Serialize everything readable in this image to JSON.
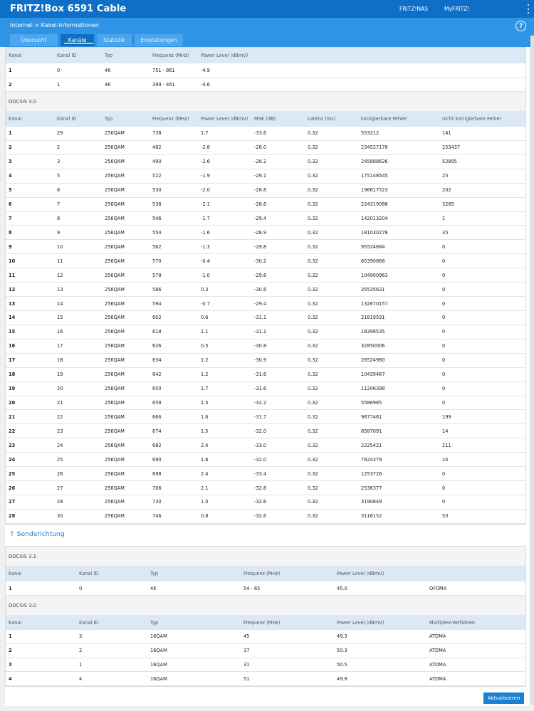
{
  "header": {
    "title": "FRITZ!Box 6591 Cable",
    "nav_nas": "FRITZ!NAS",
    "nav_myfritz": "MyFRITZ!"
  },
  "breadcrumb": {
    "parent": "Internet",
    "current": "Kabel-Informationen"
  },
  "help_label": "?",
  "tabs": [
    {
      "label": "Übersicht"
    },
    {
      "label": "Kanäle"
    },
    {
      "label": "Statistik"
    },
    {
      "label": "Einstellungen"
    }
  ],
  "downstream": {
    "ofdm_headers": [
      "Kanal",
      "Kanal ID",
      "Typ",
      "Frequenz (MHz)",
      "Power Level (dBmV)"
    ],
    "ofdm_rows": [
      [
        "1",
        "0",
        "4K",
        "751 - 861",
        "-4.9"
      ],
      [
        "2",
        "1",
        "4K",
        "399 - 461",
        "-4.6"
      ]
    ],
    "docsis30_label": "DOCSIS 3.0",
    "headers": [
      "Kanal",
      "Kanal ID",
      "Typ",
      "Frequenz (MHz)",
      "Power Level (dBmV)",
      "MSE (dB)",
      "Latenz (ms)",
      "korrigierbare Fehler",
      "nicht korrigierbare Fehler"
    ],
    "rows": [
      [
        "1",
        "29",
        "256QAM",
        "738",
        "1.7",
        "-33.6",
        "0.32",
        "553212",
        "141"
      ],
      [
        "2",
        "2",
        "256QAM",
        "482",
        "-2.8",
        "-28.0",
        "0.32",
        "234527178",
        "253437"
      ],
      [
        "3",
        "3",
        "256QAM",
        "490",
        "-2.6",
        "-28.2",
        "0.32",
        "245888626",
        "52895"
      ],
      [
        "4",
        "5",
        "256QAM",
        "522",
        "-1.9",
        "-29.1",
        "0.32",
        "175148545",
        "25"
      ],
      [
        "5",
        "6",
        "256QAM",
        "530",
        "-2.0",
        "-28.8",
        "0.32",
        "196617523",
        "202"
      ],
      [
        "6",
        "7",
        "256QAM",
        "538",
        "-2.1",
        "-28.6",
        "0.32",
        "224319086",
        "3285"
      ],
      [
        "7",
        "8",
        "256QAM",
        "546",
        "-1.7",
        "-29.4",
        "0.32",
        "142013204",
        "1"
      ],
      [
        "8",
        "9",
        "256QAM",
        "554",
        "-1.6",
        "-28.9",
        "0.32",
        "181030278",
        "35"
      ],
      [
        "9",
        "10",
        "256QAM",
        "562",
        "-1.3",
        "-29.8",
        "0.32",
        "95524684",
        "0"
      ],
      [
        "10",
        "11",
        "256QAM",
        "570",
        "-0.4",
        "-30.2",
        "0.32",
        "65390868",
        "0"
      ],
      [
        "11",
        "12",
        "256QAM",
        "578",
        "-1.0",
        "-29.6",
        "0.32",
        "104900963",
        "0"
      ],
      [
        "12",
        "13",
        "256QAM",
        "586",
        "0.3",
        "-30.6",
        "0.32",
        "35535631",
        "0"
      ],
      [
        "13",
        "14",
        "256QAM",
        "594",
        "-0.7",
        "-29.4",
        "0.32",
        "132670157",
        "0"
      ],
      [
        "14",
        "15",
        "256QAM",
        "602",
        "0.6",
        "-31.1",
        "0.32",
        "21819591",
        "0"
      ],
      [
        "15",
        "16",
        "256QAM",
        "618",
        "1.1",
        "-31.1",
        "0.32",
        "18398535",
        "0"
      ],
      [
        "16",
        "17",
        "256QAM",
        "626",
        "0.5",
        "-30.8",
        "0.32",
        "32850006",
        "0"
      ],
      [
        "17",
        "18",
        "256QAM",
        "634",
        "1.2",
        "-30.9",
        "0.32",
        "26524980",
        "0"
      ],
      [
        "18",
        "19",
        "256QAM",
        "642",
        "1.2",
        "-31.6",
        "0.32",
        "10439467",
        "0"
      ],
      [
        "19",
        "20",
        "256QAM",
        "650",
        "1.7",
        "-31.6",
        "0.32",
        "11206398",
        "0"
      ],
      [
        "20",
        "21",
        "256QAM",
        "658",
        "1.5",
        "-32.2",
        "0.32",
        "5586985",
        "0"
      ],
      [
        "21",
        "22",
        "256QAM",
        "666",
        "1.6",
        "-31.7",
        "0.32",
        "9677461",
        "199"
      ],
      [
        "22",
        "23",
        "256QAM",
        "674",
        "1.5",
        "-32.0",
        "0.32",
        "8587091",
        "14"
      ],
      [
        "23",
        "24",
        "256QAM",
        "682",
        "2.4",
        "-33.0",
        "0.32",
        "2225421",
        "211"
      ],
      [
        "24",
        "25",
        "256QAM",
        "690",
        "1.6",
        "-32.0",
        "0.32",
        "7824379",
        "24"
      ],
      [
        "25",
        "26",
        "256QAM",
        "698",
        "2.4",
        "-33.4",
        "0.32",
        "1253726",
        "0"
      ],
      [
        "26",
        "27",
        "256QAM",
        "706",
        "2.1",
        "-32.6",
        "0.32",
        "2536377",
        "0"
      ],
      [
        "27",
        "28",
        "256QAM",
        "730",
        "1.0",
        "-32.6",
        "0.32",
        "3190849",
        "0"
      ],
      [
        "28",
        "30",
        "256QAM",
        "746",
        "0.8",
        "-32.6",
        "0.32",
        "3116152",
        "53"
      ]
    ]
  },
  "upstream": {
    "title": "↑ Senderichtung",
    "docsis31_label": "DOCSIS 3.1",
    "ofdma_headers": [
      "Kanal",
      "Kanal ID",
      "Typ",
      "Frequenz (MHz)",
      "Power Level (dBmV)"
    ],
    "ofdma_rows": [
      [
        "1",
        "0",
        "4K",
        "54 - 65",
        "45.0",
        "OFDMA"
      ]
    ],
    "docsis30_label": "DOCSIS 3.0",
    "headers": [
      "Kanal",
      "Kanal ID",
      "Typ",
      "Frequenz (MHz)",
      "Power Level (dBmV)",
      "Multiplex-Verfahren"
    ],
    "rows": [
      [
        "1",
        "3",
        "16QAM",
        "45",
        "49.3",
        "ATDMA"
      ],
      [
        "2",
        "2",
        "16QAM",
        "37",
        "50.3",
        "ATDMA"
      ],
      [
        "3",
        "1",
        "16QAM",
        "31",
        "50.5",
        "ATDMA"
      ],
      [
        "4",
        "4",
        "16QAM",
        "51",
        "49.8",
        "ATDMA"
      ]
    ]
  },
  "refresh_button": "Aktualisieren"
}
